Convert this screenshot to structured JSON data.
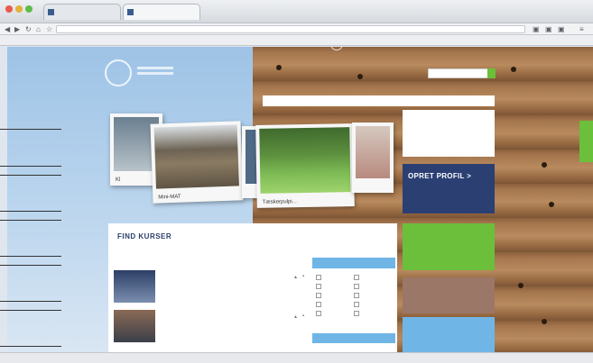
{
  "browser": {
    "tabs": [
      "",
      ""
    ],
    "address": "",
    "bookmarks": [
      "",
      "",
      "",
      "",
      "",
      "",
      "",
      "",
      ""
    ],
    "status_text": "",
    "status_right": ""
  },
  "site": {
    "search_placeholder": "",
    "menu": [
      "",
      "",
      "",
      "",
      "",
      ""
    ],
    "submenu": [
      "",
      "",
      ""
    ],
    "photo_captions": [
      "Mini-MAT",
      "Tæskerpulpi..."
    ],
    "cta": [
      {
        "small": "",
        "big": "OPRET PROFIL >",
        "color": "#2b3f73"
      },
      {
        "small": "",
        "big": "",
        "color": "#6bbf3a"
      },
      {
        "small": "",
        "big": "",
        "color": "#9b7767"
      },
      {
        "small": "",
        "big": "",
        "color": "#6fb6e6"
      }
    ],
    "courses": {
      "title": "FIND KURSER",
      "subtitle": "",
      "items": [
        {
          "name": "",
          "meta": ""
        },
        {
          "name": "",
          "meta": ""
        }
      ],
      "filter_title": "",
      "filter_options": [
        "",
        "",
        "",
        "",
        "",
        "",
        "",
        "",
        "",
        ""
      ],
      "filter_title_2": ""
    }
  }
}
